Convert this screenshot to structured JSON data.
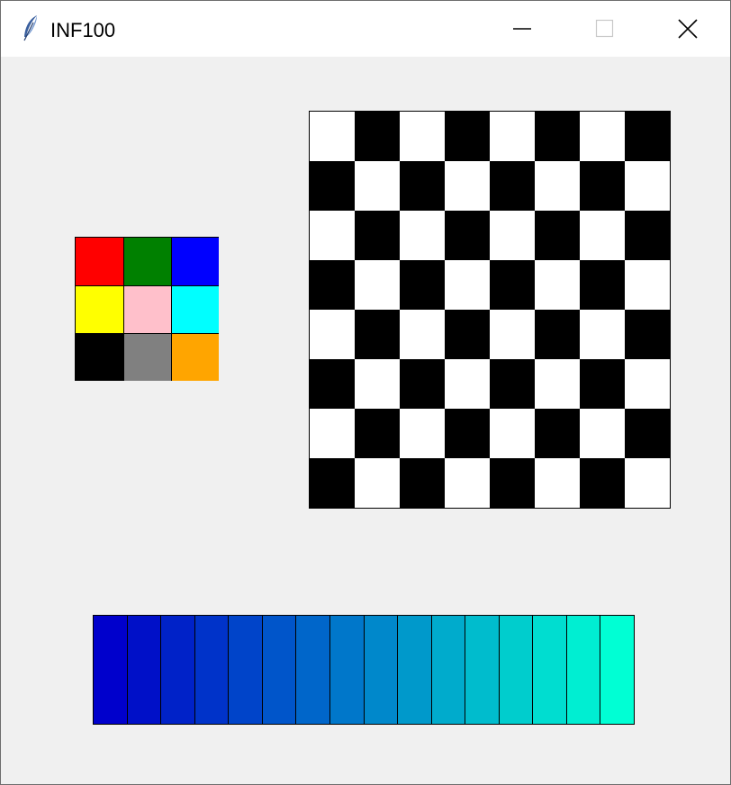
{
  "window": {
    "title": "INF100",
    "app_icon": "feather-icon",
    "controls": {
      "minimize_icon": "minimize-icon",
      "maximize_icon": "maximize-icon",
      "close_icon": "close-icon"
    }
  },
  "palette": {
    "colors": [
      "#ff0000",
      "#008000",
      "#0000ff",
      "#ffff00",
      "#ffc0cb",
      "#00ffff",
      "#000000",
      "#808080",
      "#ffa500"
    ]
  },
  "checkerboard": {
    "rows": 8,
    "columns": 8,
    "first_square": "white",
    "light_color": "#ffffff",
    "dark_color": "#000000"
  },
  "gradient": {
    "colors": [
      "#0000cc",
      "#0010c8",
      "#0022c8",
      "#0033c9",
      "#0044c9",
      "#0055ca",
      "#0066ca",
      "#0077ca",
      "#0088cb",
      "#0099cb",
      "#00abcc",
      "#00bccd",
      "#00cdcd",
      "#00ddd0",
      "#00eed2",
      "#00ffd4"
    ]
  }
}
